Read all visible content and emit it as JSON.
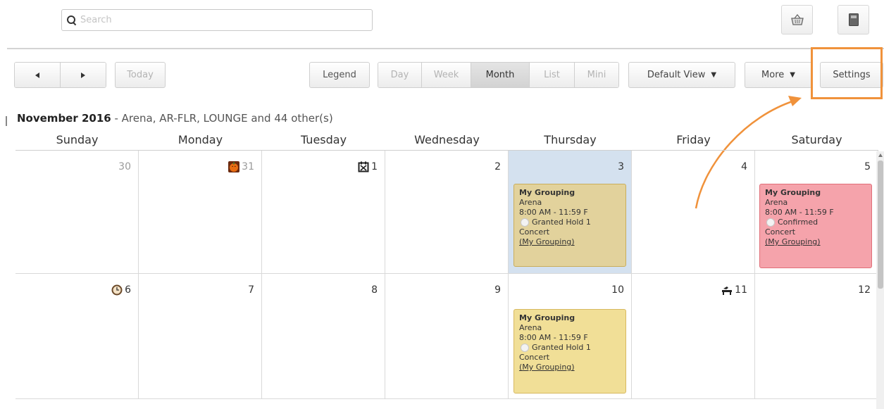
{
  "search": {
    "placeholder": "Search"
  },
  "top_icons": [
    "basket-icon",
    "book-icon"
  ],
  "toolbar": {
    "prev_icon": "triangle-left-icon",
    "next_icon": "triangle-right-icon",
    "today": "Today",
    "legend": "Legend",
    "views": [
      "Day",
      "Week",
      "Month",
      "List",
      "Mini"
    ],
    "active_view": "Month",
    "default_view": "Default View",
    "more": "More",
    "settings": "Settings"
  },
  "header": {
    "month": "November 2016",
    "separator": " - ",
    "resources": "Arena, AR-FLR, LOUNGE and 44 other(s)"
  },
  "days_of_week": [
    "Sunday",
    "Monday",
    "Tuesday",
    "Wednesday",
    "Thursday",
    "Friday",
    "Saturday"
  ],
  "weeks": [
    [
      "30",
      "31",
      "1",
      "2",
      "3",
      "4",
      "5"
    ],
    [
      "6",
      "7",
      "8",
      "9",
      "10",
      "11",
      "12"
    ]
  ],
  "events": [
    {
      "title": "My Grouping",
      "location": "Arena",
      "time": "8:00 AM - 11:59 F",
      "status": "Granted Hold 1",
      "type": "Concert",
      "link": "(My Grouping)"
    },
    {
      "title": "My Grouping",
      "location": "Arena",
      "time": "8:00 AM - 11:59 F",
      "status": "Confirmed",
      "type": "Concert",
      "link": "(My Grouping)"
    },
    {
      "title": "My Grouping",
      "location": "Arena",
      "time": "8:00 AM - 11:59 F",
      "status": "Granted Hold 1",
      "type": "Concert",
      "link": "(My Grouping)"
    }
  ],
  "colors": {
    "highlight": "#f0923b",
    "today_bg": "#d4e1ef",
    "hold": "#f1df97",
    "confirmed": "#f5a3ab"
  }
}
